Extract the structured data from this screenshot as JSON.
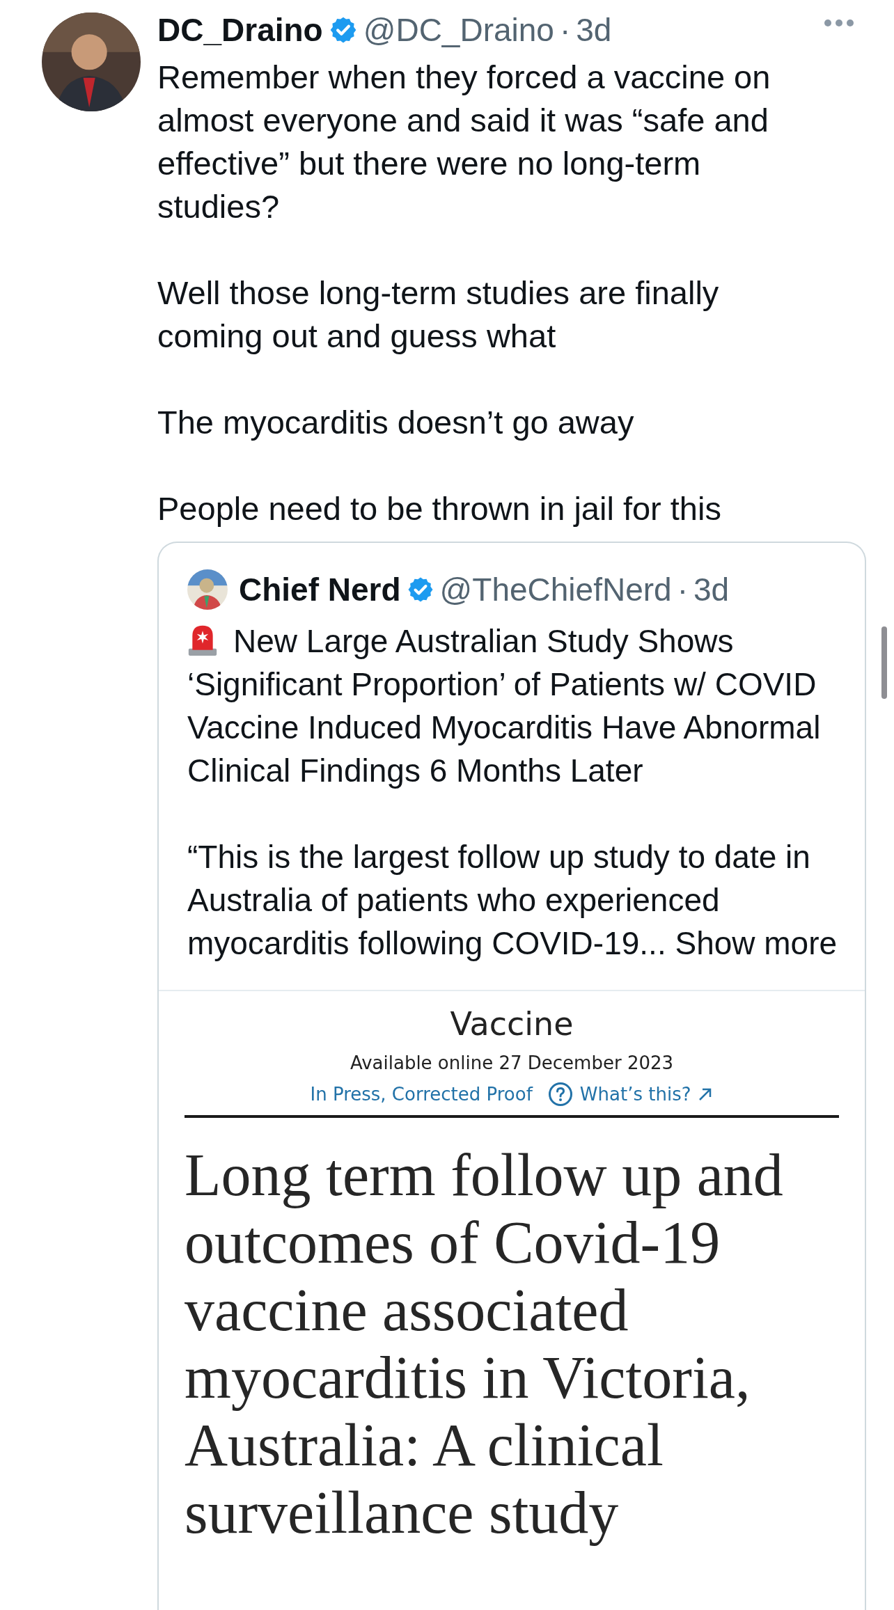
{
  "tweet": {
    "author": {
      "name": "DC_Draino",
      "verified": true,
      "handle": "@DC_Draino",
      "separator": "·",
      "time": "3d"
    },
    "paragraphs": [
      "Remember when they forced a vaccine on almost everyone and said it was “safe and effective” but there were no long-term studies?",
      "Well those long-term studies are finally coming out and guess what",
      "The myocarditis doesn’t go away",
      "People need to be thrown in jail for this"
    ],
    "quote": {
      "author": {
        "name": "Chief Nerd",
        "verified": true,
        "handle": "@TheChiefNerd",
        "separator": "·",
        "time": "3d"
      },
      "headline": "New Large Australian Study Shows ‘Significant Proportion’ of Patients w/ COVID Vaccine Induced Myocarditis Have Abnormal Clinical Findings 6 Months Later",
      "body": "“This is the largest follow up study to date in Australia of patients who experienced myocarditis following COVID-19... Show more",
      "article": {
        "journal": "Vaccine",
        "availability": "Available online 27 December 2023",
        "status": "In Press, Corrected Proof",
        "help_link": "What’s this?",
        "title": "Long term follow up and outcomes of Covid-19 vaccine associated myocarditis in Victoria, Australia: A clinical surveillance study"
      }
    }
  }
}
